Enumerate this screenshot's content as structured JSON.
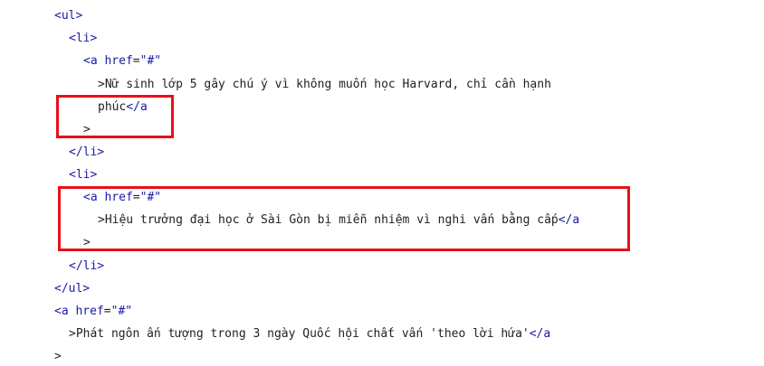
{
  "lines": [
    {
      "tag": "<ul>"
    },
    {
      "tag": "<li>"
    },
    {
      "open": "<a",
      "attr": "href",
      "eq": "=",
      "val": "\"#\""
    },
    {
      "text": ">Nữ sinh lớp 5 gây chú ý vì không muốn học Harvard, chỉ cần hạnh"
    },
    {
      "text": "phúc",
      "close": "</a"
    },
    {
      "text": ">"
    },
    {
      "tag": "</li>"
    },
    {
      "tag": "<li>"
    },
    {
      "open": "<a",
      "attr": "href",
      "eq": "=",
      "val": "\"#\""
    },
    {
      "text": ">Hiệu trưởng đại học ở Sài Gòn bị miễn nhiệm vì nghi vấn bằng cấp",
      "close": "</a"
    },
    {
      "text": ">"
    },
    {
      "tag": "</li>"
    },
    {
      "tag": "</ul>"
    },
    {
      "open": "<a",
      "attr": "href",
      "eq": "=",
      "val": "\"#\""
    },
    {
      "text": ">Phát ngôn ấn tượng trong 3 ngày Quốc hội chất vấn 'theo lời hứa'",
      "close": "</a"
    },
    {
      "text": ">"
    }
  ],
  "highlight_color": "#e8101a"
}
